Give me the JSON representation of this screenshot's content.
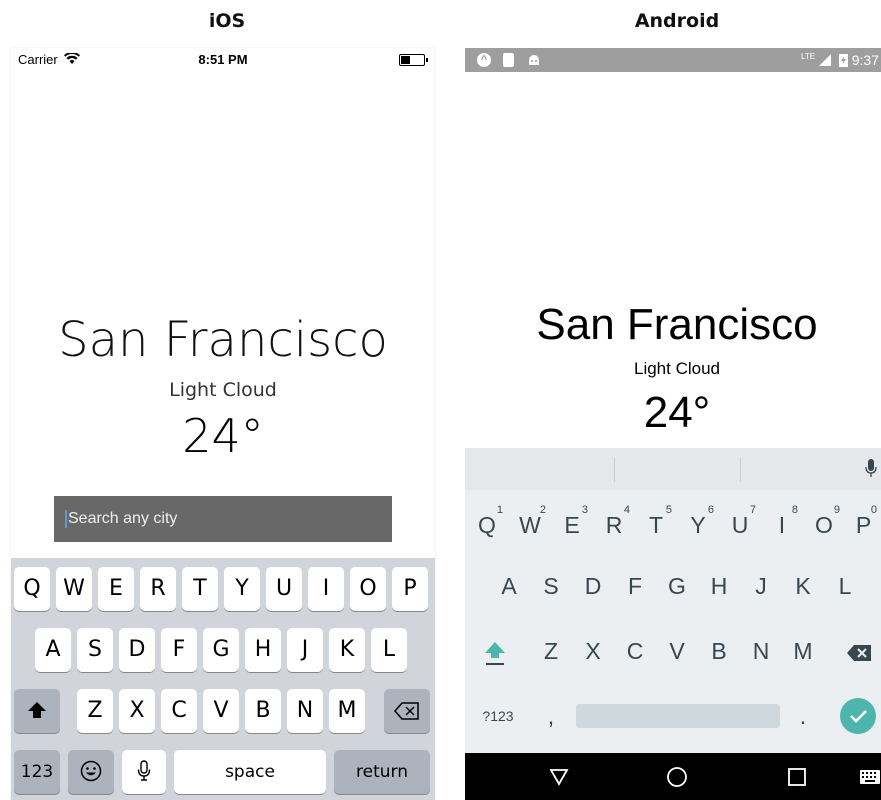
{
  "titles": {
    "ios": "iOS",
    "android": "Android"
  },
  "ios": {
    "status": {
      "carrier": "Carrier",
      "time": "8:51 PM"
    },
    "city": "San Francisco",
    "weather": "Light Cloud",
    "temperature": "24°",
    "search": {
      "placeholder": "Search any city"
    },
    "keyboard": {
      "row1": [
        "Q",
        "W",
        "E",
        "R",
        "T",
        "Y",
        "U",
        "I",
        "O",
        "P"
      ],
      "row2": [
        "A",
        "S",
        "D",
        "F",
        "G",
        "H",
        "J",
        "K",
        "L"
      ],
      "row3": [
        "Z",
        "X",
        "C",
        "V",
        "B",
        "N",
        "M"
      ],
      "numbers_key": "123",
      "space_key": "space",
      "return_key": "return"
    }
  },
  "android": {
    "status": {
      "time": "9:37",
      "network": "LTE"
    },
    "city": "San Francisco",
    "weather": "Light Cloud",
    "temperature": "24°",
    "keyboard": {
      "row1": [
        "Q",
        "W",
        "E",
        "R",
        "T",
        "Y",
        "U",
        "I",
        "O",
        "P"
      ],
      "row1_hints": [
        "1",
        "2",
        "3",
        "4",
        "5",
        "6",
        "7",
        "8",
        "9",
        "0"
      ],
      "row2": [
        "A",
        "S",
        "D",
        "F",
        "G",
        "H",
        "J",
        "K",
        "L"
      ],
      "row3": [
        "Z",
        "X",
        "C",
        "V",
        "B",
        "N",
        "M"
      ],
      "symbols_key": "?123",
      "comma_key": ",",
      "period_key": "."
    },
    "accent_color": "#4db6ac"
  }
}
